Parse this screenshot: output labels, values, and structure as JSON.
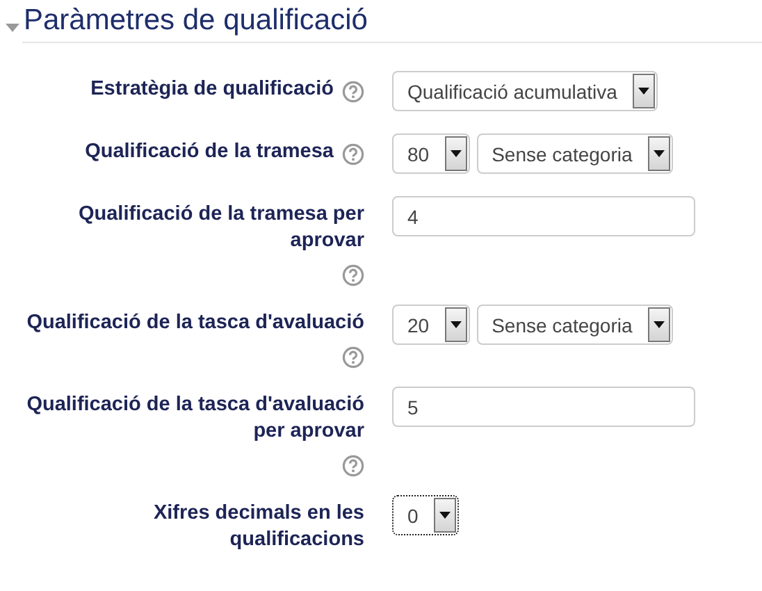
{
  "section": {
    "title": "Paràmetres de qualificació",
    "expanded": true
  },
  "fields": [
    {
      "label": "Estratègia de qualificació",
      "help": true,
      "controls": [
        {
          "kind": "select",
          "value": "Qualificació acumulativa",
          "focused": false
        }
      ]
    },
    {
      "label": "Qualificació de la tramesa",
      "help": true,
      "controls": [
        {
          "kind": "select",
          "value": "80",
          "focused": false
        },
        {
          "kind": "select",
          "value": "Sense categoria",
          "focused": false
        }
      ]
    },
    {
      "label": "Qualificació de la tramesa per aprovar",
      "help": true,
      "controls": [
        {
          "kind": "text",
          "value": "4"
        }
      ]
    },
    {
      "label": "Qualificació de la tasca d'avaluació",
      "help": true,
      "controls": [
        {
          "kind": "select",
          "value": "20",
          "focused": false
        },
        {
          "kind": "select",
          "value": "Sense categoria",
          "focused": false
        }
      ]
    },
    {
      "label": "Qualificació de la tasca d'avaluació per aprovar",
      "help": true,
      "controls": [
        {
          "kind": "text",
          "value": "5"
        }
      ]
    },
    {
      "label": "Xifres decimals en les qualificacions",
      "help": false,
      "controls": [
        {
          "kind": "select",
          "value": "0",
          "focused": true
        }
      ]
    }
  ]
}
